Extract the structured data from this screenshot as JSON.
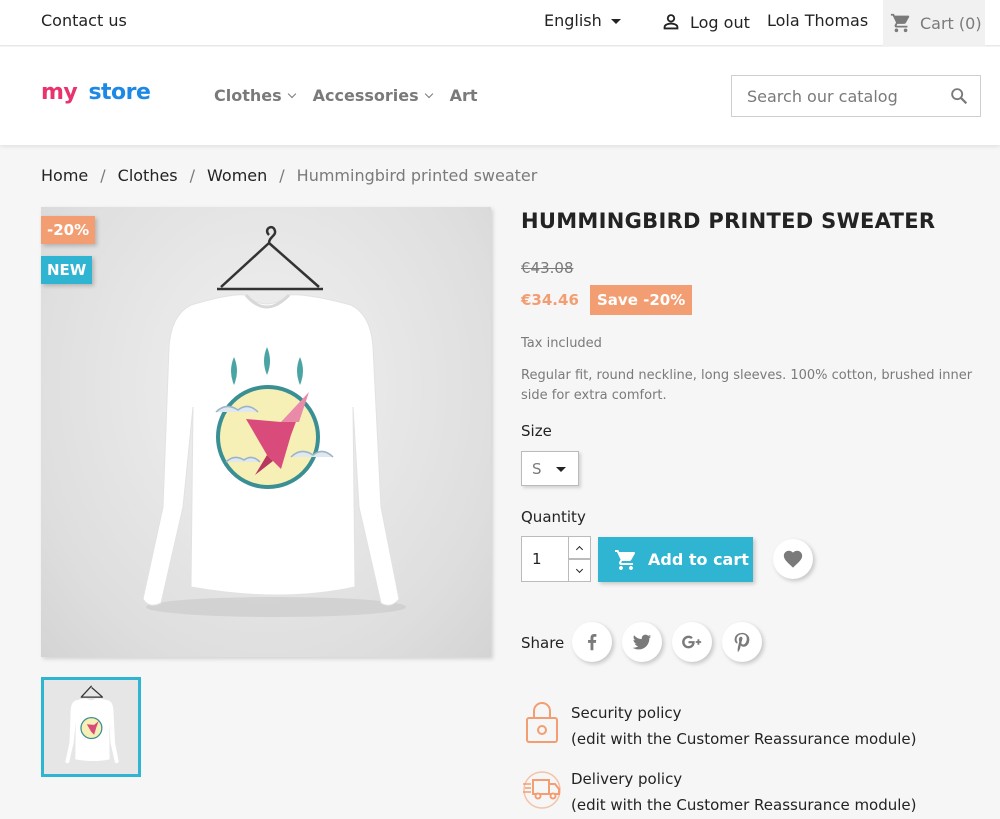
{
  "topnav": {
    "contact": "Contact us",
    "language": "English",
    "logout": "Log out",
    "username": "Lola Thomas",
    "cart": "Cart (0)"
  },
  "header": {
    "logo_my": "my",
    "logo_store": "store",
    "menu": [
      {
        "label": "Clothes"
      },
      {
        "label": "Accessories"
      },
      {
        "label": "Art"
      }
    ],
    "search_placeholder": "Search our catalog"
  },
  "breadcrumb": [
    "Home",
    "Clothes",
    "Women",
    "Hummingbird printed sweater"
  ],
  "product": {
    "badge_discount": "-20%",
    "badge_new": "NEW",
    "title": "HUMMINGBIRD PRINTED SWEATER",
    "old_price": "€43.08",
    "price": "€34.46",
    "save": "Save -20%",
    "tax": "Tax included",
    "description": "Regular fit, round neckline, long sleeves. 100% cotton, brushed inner side for extra comfort.",
    "size_label": "Size",
    "size_value": "S",
    "quantity_label": "Quantity",
    "quantity_value": "1",
    "add_to_cart": "Add to cart",
    "share_label": "Share"
  },
  "social": [
    "facebook-icon",
    "twitter-icon",
    "google-plus-icon",
    "pinterest-icon"
  ],
  "reassurance": [
    {
      "title": "Security policy",
      "text": "(edit with the Customer Reassurance module)"
    },
    {
      "title": "Delivery policy",
      "text": "(edit with the Customer Reassurance module)"
    }
  ],
  "colors": {
    "accent": "#2fb5d2",
    "discount": "#f39d72"
  }
}
